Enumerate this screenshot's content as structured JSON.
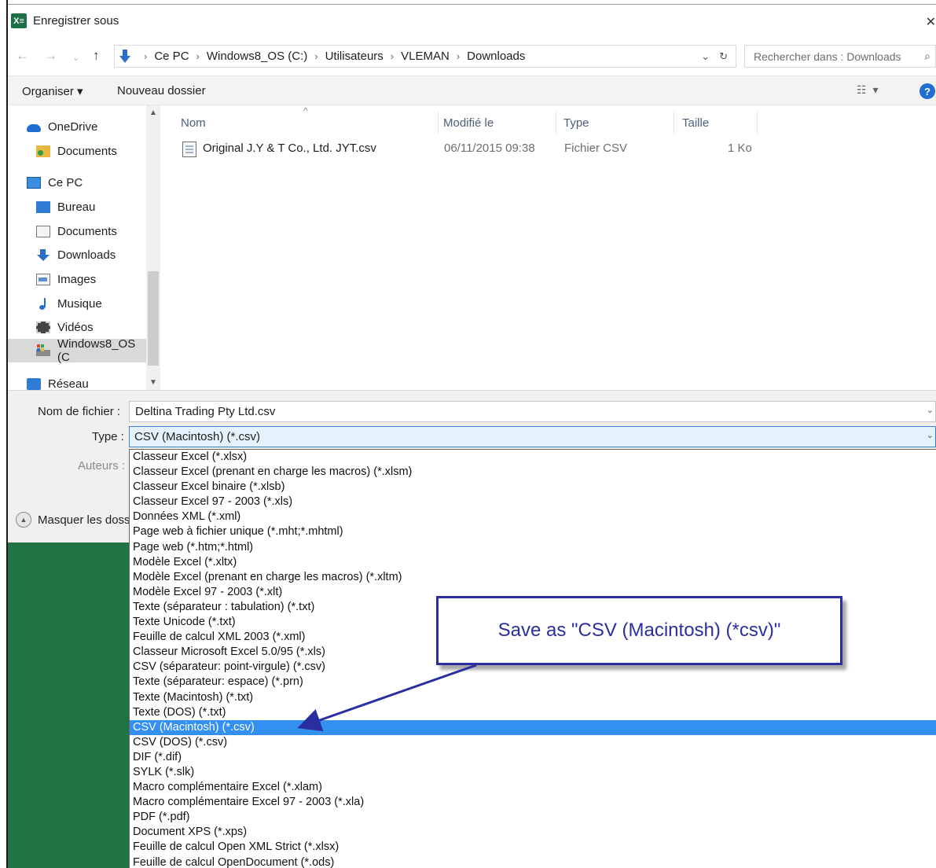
{
  "window": {
    "app_icon_text": "X≡",
    "title": "Enregistrer sous",
    "close": "✕"
  },
  "address": {
    "back": "←",
    "forward": "→",
    "recent": "⌄",
    "up": "↑",
    "crumbs": [
      "Ce PC",
      "Windows8_OS (C:)",
      "Utilisateurs",
      "VLEMAN",
      "Downloads"
    ],
    "separator": "›",
    "history_chevron": "⌄",
    "refresh": "↻",
    "search_placeholder": "Rechercher dans : Downloads",
    "search_icon": "⌕"
  },
  "toolbar": {
    "organise": "Organiser ▾",
    "new_folder": "Nouveau dossier",
    "view_icon": "☷ ▾",
    "help": "?"
  },
  "nav": {
    "items": [
      {
        "label": "OneDrive",
        "icon": "cloud"
      },
      {
        "label": "Documents",
        "icon": "folder-doc"
      },
      {
        "label": "Ce PC",
        "icon": "pc"
      },
      {
        "label": "Bureau",
        "icon": "desktop"
      },
      {
        "label": "Documents",
        "icon": "documents"
      },
      {
        "label": "Downloads",
        "icon": "download"
      },
      {
        "label": "Images",
        "icon": "images"
      },
      {
        "label": "Musique",
        "icon": "music"
      },
      {
        "label": "Vidéos",
        "icon": "video"
      },
      {
        "label": "Windows8_OS (C",
        "icon": "drive"
      },
      {
        "label": "Réseau",
        "icon": "network"
      }
    ],
    "scroll_up": "▲",
    "scroll_down": "▼"
  },
  "files": {
    "sort_caret": "^",
    "columns": [
      "Nom",
      "Modifié le",
      "Type",
      "Taille"
    ],
    "rows": [
      {
        "name": "Original J.Y & T Co., Ltd. JYT.csv",
        "modified": "06/11/2015 09:38",
        "type": "Fichier CSV",
        "size": "1 Ko"
      }
    ]
  },
  "form": {
    "filename_label": "Nom de fichier :",
    "filename_value": "Deltina Trading Pty Ltd.csv",
    "type_label": "Type :",
    "type_value": "CSV (Macintosh) (*.csv)",
    "authors_label": "Auteurs :",
    "hide_folders": "Masquer les dossi",
    "chevron": "⌄",
    "hide_chevron": "▲"
  },
  "type_options": [
    "Classeur Excel (*.xlsx)",
    "Classeur Excel (prenant en charge les macros) (*.xlsm)",
    "Classeur Excel binaire (*.xlsb)",
    "Classeur Excel 97 - 2003 (*.xls)",
    "Données XML (*.xml)",
    "Page web à fichier unique (*.mht;*.mhtml)",
    "Page web (*.htm;*.html)",
    "Modèle Excel (*.xltx)",
    "Modèle Excel (prenant en charge les macros) (*.xltm)",
    "Modèle Excel 97 - 2003 (*.xlt)",
    "Texte (séparateur : tabulation) (*.txt)",
    "Texte Unicode (*.txt)",
    "Feuille de calcul XML 2003 (*.xml)",
    "Classeur Microsoft Excel 5.0/95 (*.xls)",
    "CSV (séparateur: point-virgule) (*.csv)",
    "Texte (séparateur: espace) (*.prn)",
    "Texte (Macintosh) (*.txt)",
    "Texte (DOS) (*.txt)",
    "CSV (Macintosh) (*.csv)",
    "CSV (DOS) (*.csv)",
    "DIF (*.dif)",
    "SYLK (*.slk)",
    "Macro complémentaire Excel (*.xlam)",
    "Macro complémentaire Excel 97 - 2003 (*.xla)",
    "PDF (*.pdf)",
    "Document XPS (*.xps)",
    "Feuille de calcul Open XML Strict (*.xlsx)",
    "Feuille de calcul OpenDocument (*.ods)"
  ],
  "selected_option_index": 18,
  "annotation": {
    "text": "Save as \"CSV (Macintosh) (*csv)\"",
    "color": "#2a2ea0"
  },
  "colors": {
    "excel_green": "#217346",
    "selection_blue": "#3390f0"
  }
}
